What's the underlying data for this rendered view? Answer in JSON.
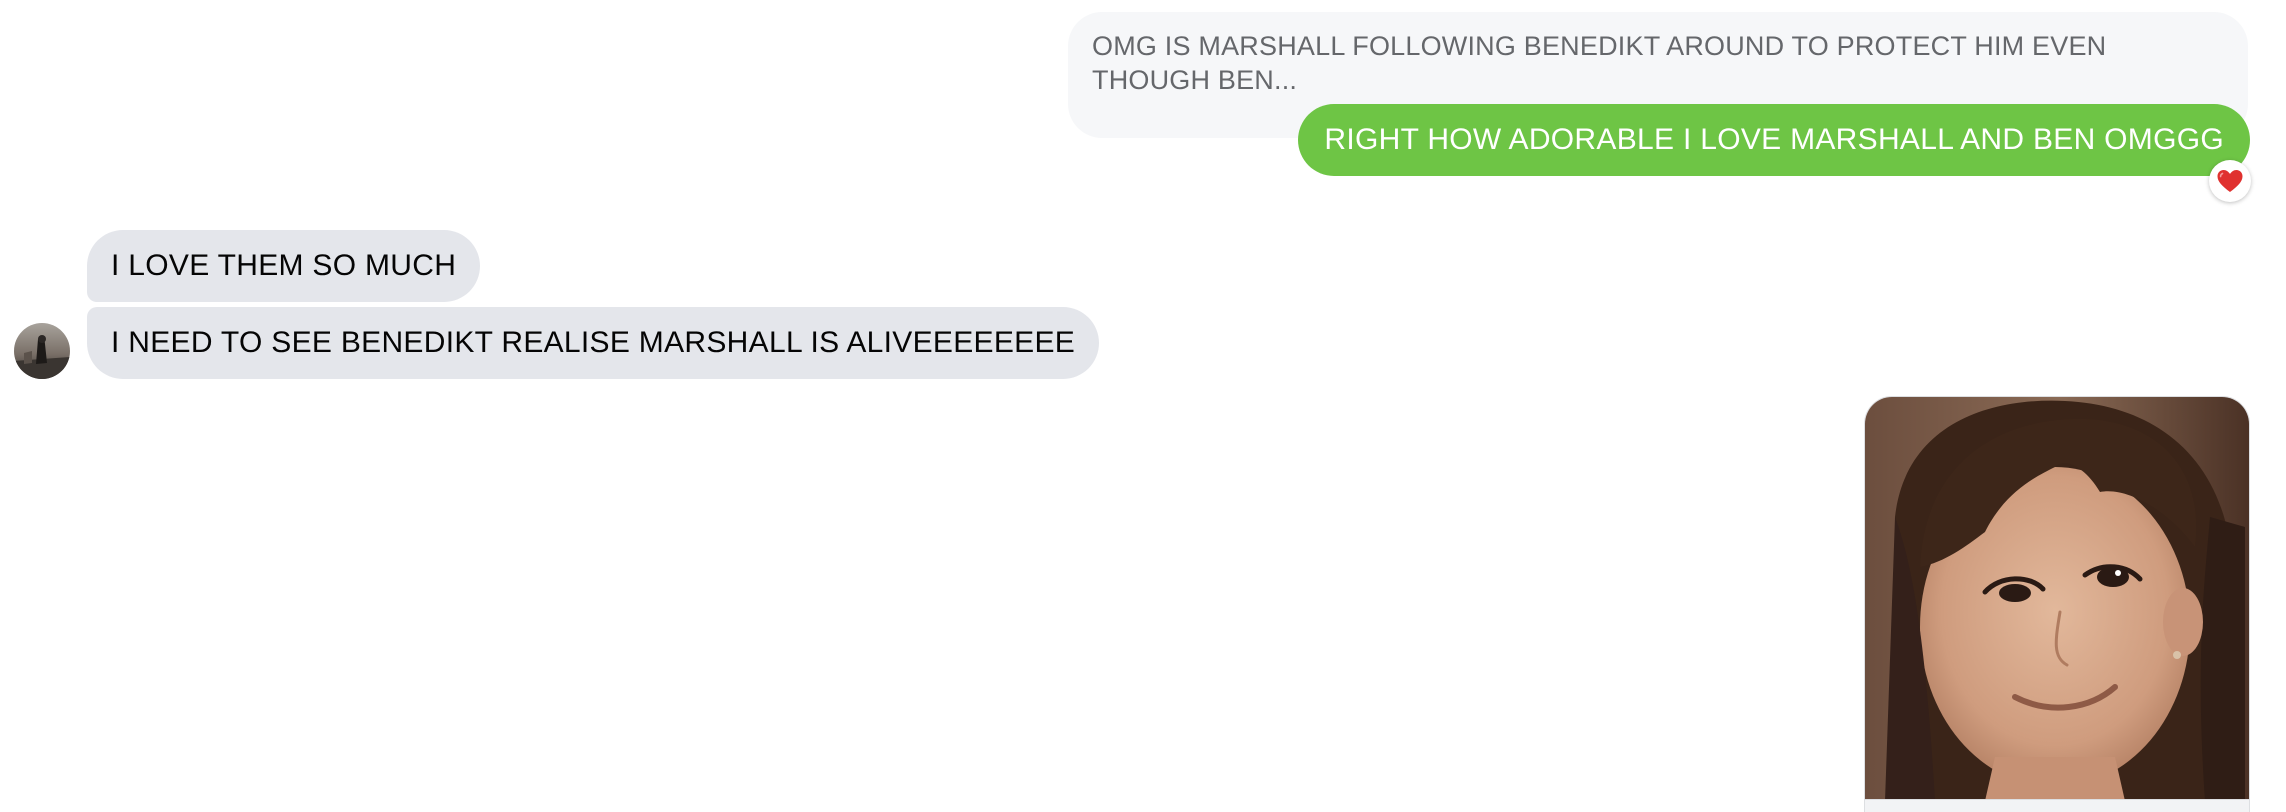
{
  "conversation": {
    "quoted_message": {
      "text": "OMG IS MARSHALL FOLLOWING BENEDIKT AROUND TO PROTECT HIM EVEN THOUGH BEN..."
    },
    "messages": [
      {
        "direction": "outgoing",
        "text": "RIGHT HOW ADORABLE I LOVE MARSHALL AND BEN OMGGG",
        "reaction": "heart-reaction-icon"
      },
      {
        "direction": "incoming",
        "text": "I LOVE THEM SO MUCH"
      },
      {
        "direction": "incoming",
        "text": "I NEED TO SEE BENEDIKT REALISE MARSHALL IS ALIVEEEEEEEE"
      },
      {
        "direction": "outgoing",
        "type": "image"
      }
    ]
  },
  "colors": {
    "outgoing_bubble": "#6ec545",
    "incoming_bubble": "#e4e6eb",
    "quote_background": "#f6f7f9",
    "reaction_heart": "#e0312f"
  }
}
